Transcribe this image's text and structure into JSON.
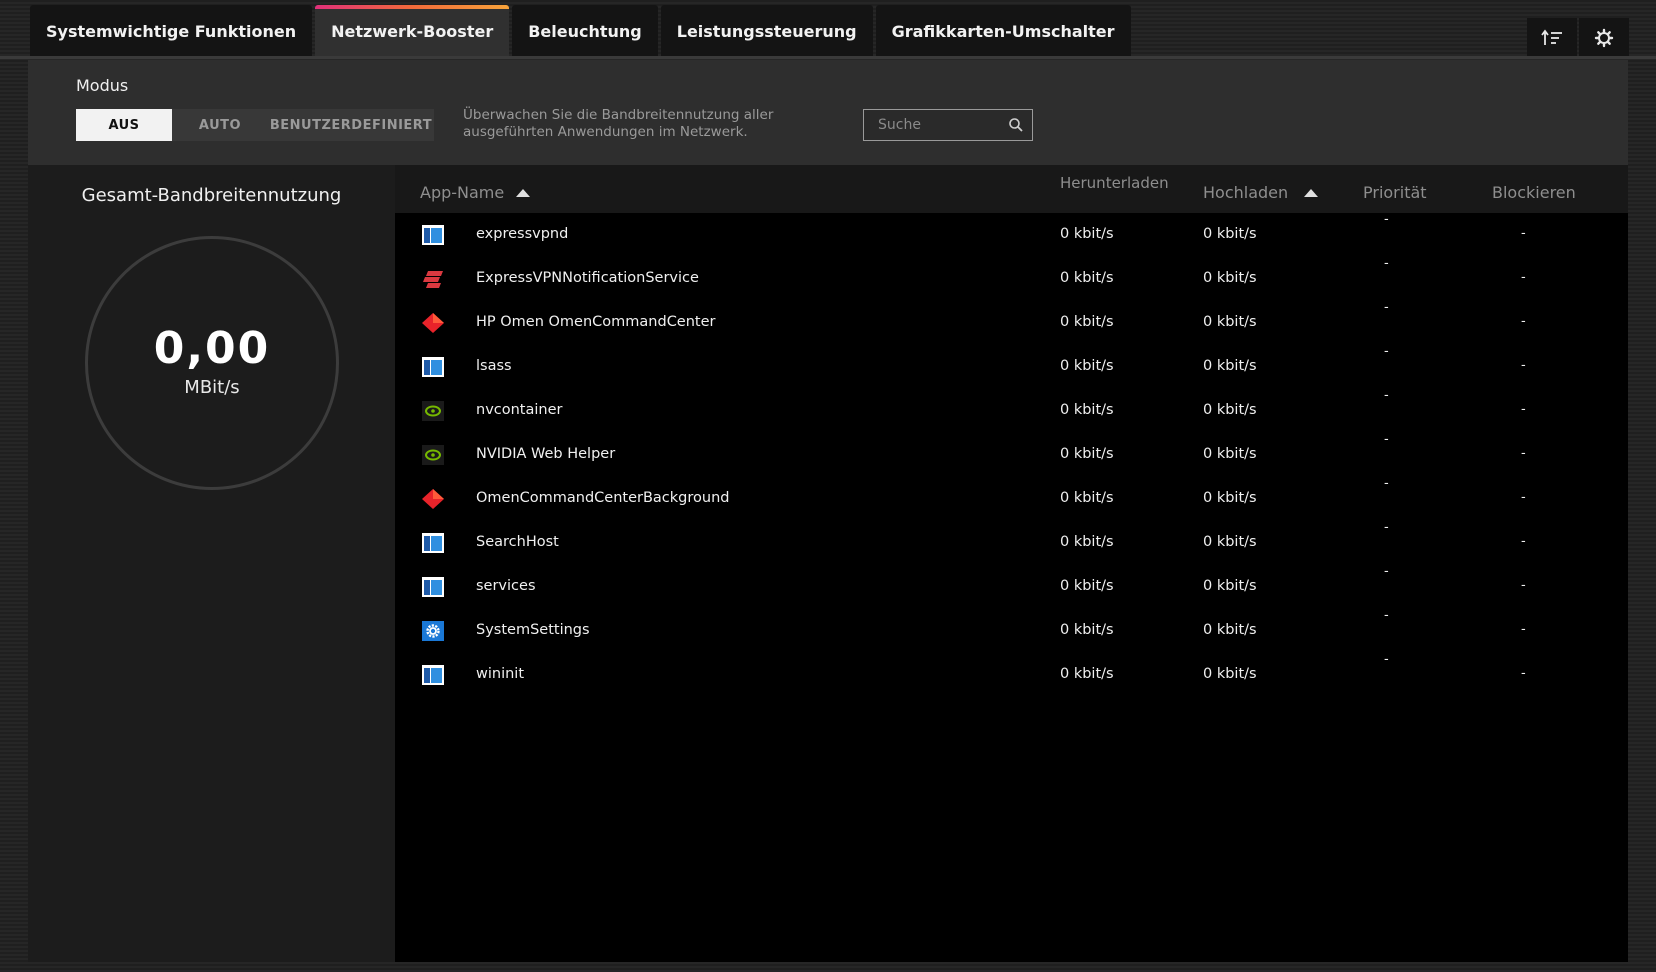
{
  "tabs": [
    {
      "label": "Systemwichtige Funktionen",
      "active": false
    },
    {
      "label": "Netzwerk-Booster",
      "active": true
    },
    {
      "label": "Beleuchtung",
      "active": false
    },
    {
      "label": "Leistungssteuerung",
      "active": false
    },
    {
      "label": "Grafikkarten-Umschalter",
      "active": false
    }
  ],
  "toolbar": {
    "sort_icon": "sort-icon",
    "settings_icon": "gear-icon"
  },
  "mode": {
    "label": "Modus",
    "options": [
      "AUS",
      "AUTO",
      "BENUTZERDEFINIERT"
    ],
    "selected": "AUS",
    "description": "Überwachen Sie die Bandbreitennutzung aller ausgeführten Anwendungen im Netzwerk."
  },
  "search": {
    "placeholder": "Suche",
    "value": ""
  },
  "bandwidth": {
    "title": "Gesamt-Bandbreitennutzung",
    "value": "0,00",
    "unit": "MBit/s"
  },
  "table": {
    "headers": {
      "name": "App-Name",
      "download": "Herunterladen",
      "upload": "Hochladen",
      "priority": "Priorität",
      "block": "Blockieren"
    },
    "rows": [
      {
        "icon": "window-icon",
        "name": "expressvpnd",
        "download": "0 kbit/s",
        "upload": "0 kbit/s",
        "priority": "-",
        "block": "-"
      },
      {
        "icon": "expressvpn-icon",
        "name": "ExpressVPNNotificationService",
        "download": "0 kbit/s",
        "upload": "0 kbit/s",
        "priority": "-",
        "block": "-"
      },
      {
        "icon": "omen-icon",
        "name": "HP Omen OmenCommandCenter",
        "download": "0 kbit/s",
        "upload": "0 kbit/s",
        "priority": "-",
        "block": "-"
      },
      {
        "icon": "window-icon",
        "name": "lsass",
        "download": "0 kbit/s",
        "upload": "0 kbit/s",
        "priority": "-",
        "block": "-"
      },
      {
        "icon": "nvidia-icon",
        "name": "nvcontainer",
        "download": "0 kbit/s",
        "upload": "0 kbit/s",
        "priority": "-",
        "block": "-"
      },
      {
        "icon": "nvidia-icon",
        "name": "NVIDIA Web Helper",
        "download": "0 kbit/s",
        "upload": "0 kbit/s",
        "priority": "-",
        "block": "-"
      },
      {
        "icon": "omen-icon",
        "name": "OmenCommandCenterBackground",
        "download": "0 kbit/s",
        "upload": "0 kbit/s",
        "priority": "-",
        "block": "-"
      },
      {
        "icon": "window-icon",
        "name": "SearchHost",
        "download": "0 kbit/s",
        "upload": "0 kbit/s",
        "priority": "-",
        "block": "-"
      },
      {
        "icon": "window-icon",
        "name": "services",
        "download": "0 kbit/s",
        "upload": "0 kbit/s",
        "priority": "-",
        "block": "-"
      },
      {
        "icon": "settings-app-icon",
        "name": "SystemSettings",
        "download": "0 kbit/s",
        "upload": "0 kbit/s",
        "priority": "-",
        "block": "-"
      },
      {
        "icon": "window-icon",
        "name": "wininit",
        "download": "0 kbit/s",
        "upload": "0 kbit/s",
        "priority": "-",
        "block": "-"
      }
    ]
  },
  "colors": {
    "accent_gradient_start": "#e0307a",
    "accent_gradient_end": "#f7a33a",
    "active_segment": "#f2f2f2"
  }
}
